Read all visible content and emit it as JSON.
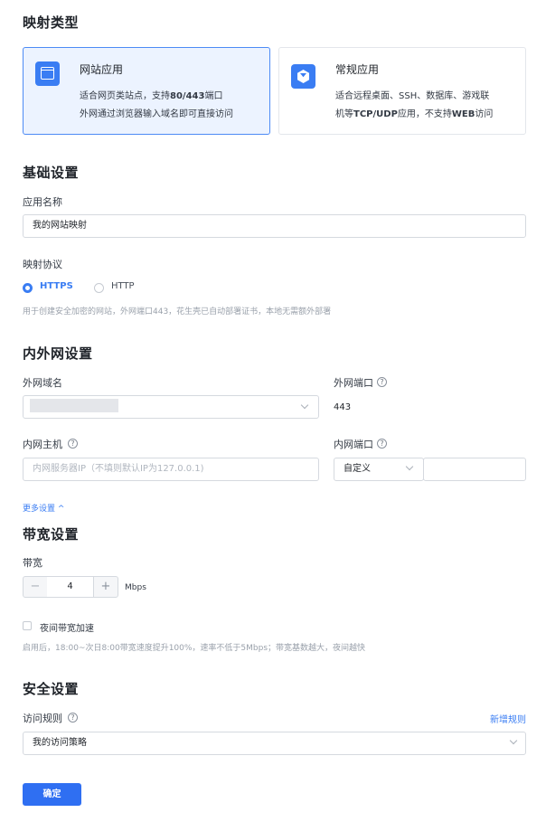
{
  "mapping_type": {
    "title": "映射类型",
    "web": {
      "title": "网站应用",
      "desc_line1_prefix": "适合网页类站点，支持",
      "desc_line1_bold": "80/443",
      "desc_line1_suffix": "端口",
      "desc_line2": "外网通过浏览器输入域名即可直接访问",
      "icon": "browser-window-icon"
    },
    "general": {
      "title": "常规应用",
      "desc_line1": "适合远程桌面、SSH、数据库、游戏联",
      "desc_line2_prefix": "机等",
      "desc_line2_bold1": "TCP/UDP",
      "desc_line2_mid": "应用，不支持",
      "desc_line2_bold2": "WEB",
      "desc_line2_suffix": "访问",
      "icon": "cube-icon"
    }
  },
  "basic": {
    "title": "基础设置",
    "app_name_label": "应用名称",
    "app_name_value": "我的网站映射",
    "protocol_label": "映射协议",
    "protocol_options": [
      "HTTPS",
      "HTTP"
    ],
    "protocol_selected": "HTTPS",
    "protocol_hint": "用于创建安全加密的网站，外网端口443，花生壳已自动部署证书，本地无需额外部署"
  },
  "network": {
    "title": "内外网设置",
    "ext_domain_label": "外网域名",
    "ext_port_label": "外网端口",
    "ext_port_value": "443",
    "int_host_label": "内网主机",
    "int_host_placeholder": "内网服务器IP（不填则默认IP为127.0.0.1)",
    "int_port_label": "内网端口",
    "int_port_mode": "自定义",
    "more_settings": "更多设置 ^"
  },
  "bandwidth": {
    "title": "带宽设置",
    "label": "带宽",
    "value": "4",
    "unit": "Mbps",
    "minus": "−",
    "plus": "+",
    "night_label": "夜间带宽加速",
    "night_checked": false,
    "night_hint": "启用后，18:00~次日8:00带宽速度提升100%，速率不低于5Mbps；带宽基数越大，夜间越快"
  },
  "security": {
    "title": "安全设置",
    "rule_label": "访问规则",
    "new_rule": "新增规则",
    "rule_value": "我的访问策略"
  },
  "confirm_label": "确定",
  "colors": {
    "accent": "#3a7df3",
    "card_selected_bg": "#ecf3ff",
    "card_selected_border": "#4d8bf5"
  }
}
